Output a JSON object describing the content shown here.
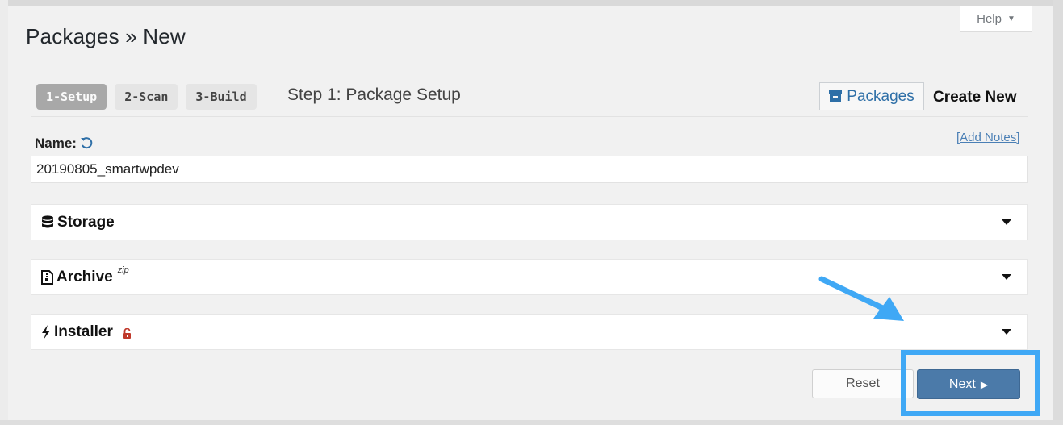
{
  "header": {
    "help_label": "Help",
    "page_title": "Packages » New"
  },
  "steps": {
    "items": [
      {
        "label": "1-Setup",
        "active": true
      },
      {
        "label": "2-Scan",
        "active": false
      },
      {
        "label": "3-Build",
        "active": false
      }
    ],
    "title": "Step 1: Package Setup"
  },
  "nav": {
    "packages_label": "Packages",
    "create_new_label": "Create New"
  },
  "form": {
    "name_label": "Name:",
    "add_notes_label": "[Add Notes]",
    "name_value": "20190805_smartwpdev"
  },
  "panels": {
    "storage": {
      "title": "Storage"
    },
    "archive": {
      "title": "Archive",
      "sup": "zip"
    },
    "installer": {
      "title": "Installer"
    }
  },
  "actions": {
    "reset_label": "Reset",
    "next_label": "Next",
    "next_arrow": "▶"
  },
  "colors": {
    "accent": "#4b7aa9",
    "link": "#2e6fa7",
    "annotation": "#3fa8f5",
    "lock": "#c0392b"
  }
}
